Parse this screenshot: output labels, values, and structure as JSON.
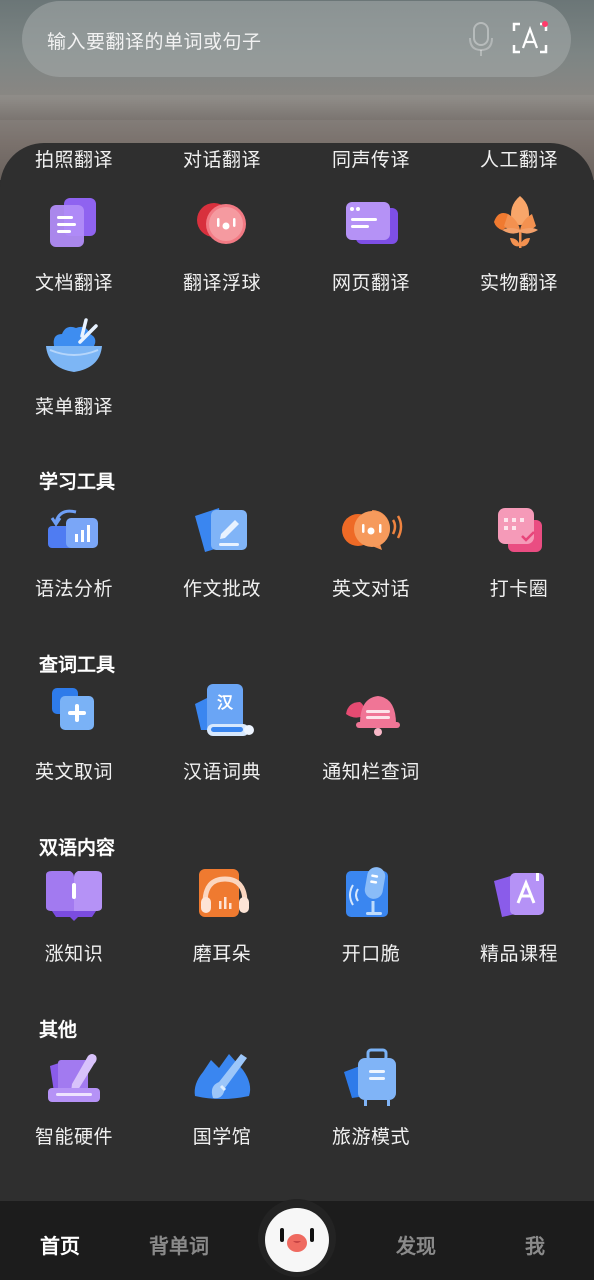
{
  "search": {
    "placeholder": "输入要翻译的单词或句子",
    "mic_icon": "microphone-icon",
    "scan_icon": "text-scan-icon",
    "badge_color": "#ff3b6b"
  },
  "translate_tools": {
    "top_labels": [
      "拍照翻译",
      "对话翻译",
      "同声传译",
      "人工翻译"
    ],
    "items": [
      {
        "label": "文档翻译",
        "icon": "document-icon"
      },
      {
        "label": "翻译浮球",
        "icon": "floating-ball-icon"
      },
      {
        "label": "网页翻译",
        "icon": "webpage-icon"
      },
      {
        "label": "实物翻译",
        "icon": "flower-icon"
      },
      {
        "label": "菜单翻译",
        "icon": "rice-bowl-icon"
      }
    ]
  },
  "sections": [
    {
      "title": "学习工具",
      "items": [
        {
          "label": "语法分析",
          "icon": "grammar-chart-icon"
        },
        {
          "label": "作文批改",
          "icon": "essay-pen-icon"
        },
        {
          "label": "英文对话",
          "icon": "chat-voice-icon"
        },
        {
          "label": "打卡圈",
          "icon": "calendar-check-icon"
        }
      ]
    },
    {
      "title": "查词工具",
      "items": [
        {
          "label": "英文取词",
          "icon": "add-word-icon"
        },
        {
          "label": "汉语词典",
          "icon": "chinese-dictionary-icon"
        },
        {
          "label": "通知栏查词",
          "icon": "bell-icon"
        }
      ]
    },
    {
      "title": "双语内容",
      "items": [
        {
          "label": "涨知识",
          "icon": "open-book-icon"
        },
        {
          "label": "磨耳朵",
          "icon": "headphones-icon"
        },
        {
          "label": "开口脆",
          "icon": "microphone-card-icon"
        },
        {
          "label": "精品课程",
          "icon": "course-card-icon"
        }
      ]
    },
    {
      "title": "其他",
      "items": [
        {
          "label": "智能硬件",
          "icon": "smart-pen-icon"
        },
        {
          "label": "国学馆",
          "icon": "brush-mountain-icon"
        },
        {
          "label": "旅游模式",
          "icon": "luggage-icon"
        }
      ]
    }
  ],
  "tabbar": {
    "tabs": [
      {
        "label": "首页",
        "active": true
      },
      {
        "label": "背单词",
        "active": false
      },
      {
        "label": "发现",
        "active": false
      },
      {
        "label": "我",
        "active": false
      }
    ],
    "center_icon": "mascot-face-icon"
  },
  "colors": {
    "panel_bg": "#2f2f2f",
    "tabbar_bg": "#1c1c1c",
    "active_tab": "#ffffff",
    "inactive_tab": "#8a8a8a"
  }
}
